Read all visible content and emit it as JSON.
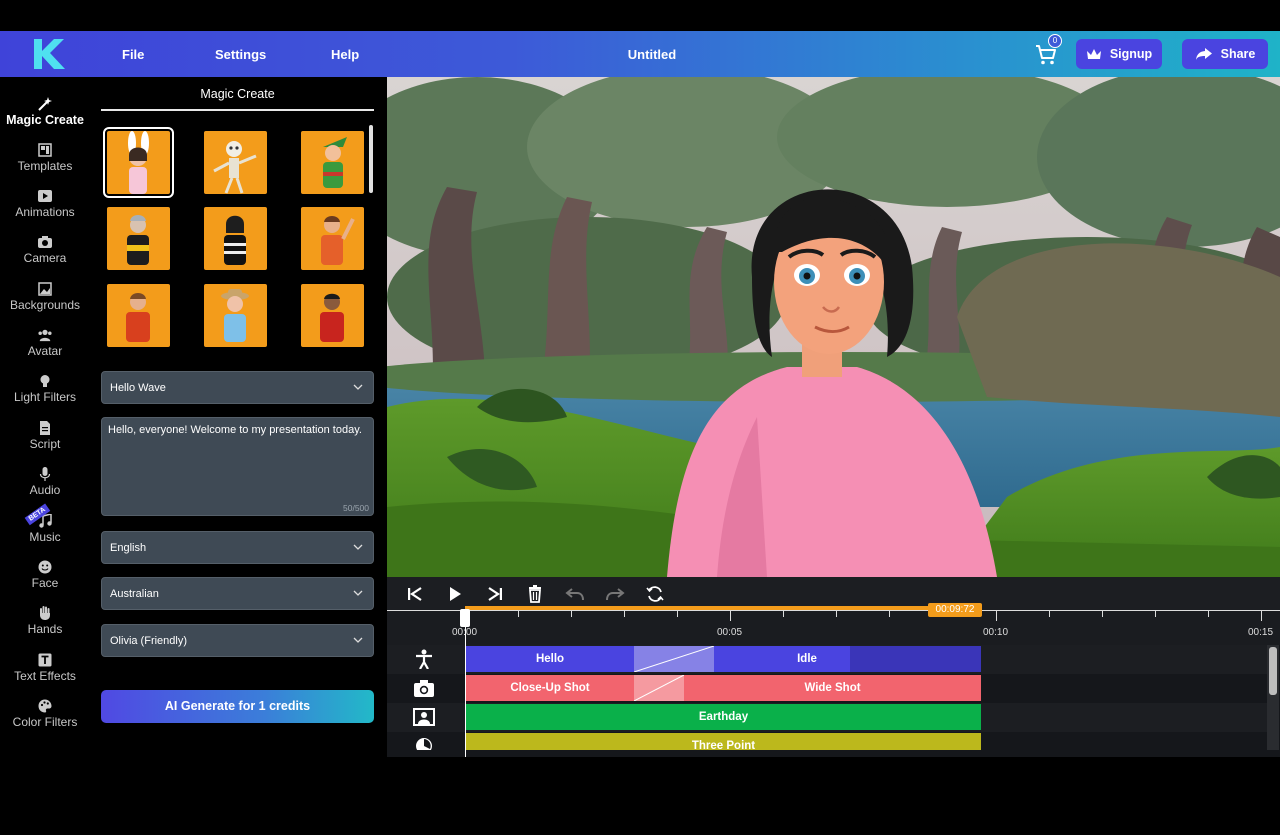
{
  "app": {
    "title": "Untitled",
    "menu": [
      "File",
      "Settings",
      "Help"
    ],
    "cart_count": "0",
    "signup_label": "Signup",
    "share_label": "Share"
  },
  "sidebar": {
    "items": [
      {
        "label": "Magic Create",
        "icon": "magic-wand-icon"
      },
      {
        "label": "Templates",
        "icon": "templates-icon"
      },
      {
        "label": "Animations",
        "icon": "play-icon"
      },
      {
        "label": "Camera",
        "icon": "camera-icon"
      },
      {
        "label": "Backgrounds",
        "icon": "image-icon"
      },
      {
        "label": "Avatar",
        "icon": "people-icon"
      },
      {
        "label": "Light Filters",
        "icon": "bulb-icon"
      },
      {
        "label": "Script",
        "icon": "document-icon"
      },
      {
        "label": "Audio",
        "icon": "microphone-icon"
      },
      {
        "label": "Music",
        "icon": "music-icon",
        "badge": "BETA"
      },
      {
        "label": "Face",
        "icon": "smile-icon"
      },
      {
        "label": "Hands",
        "icon": "hand-icon"
      },
      {
        "label": "Text Effects",
        "icon": "text-icon"
      },
      {
        "label": "Color Filters",
        "icon": "palette-icon"
      }
    ]
  },
  "panel": {
    "title": "Magic Create",
    "animation_select": "Hello Wave",
    "script_text": "Hello, everyone! Welcome to my presentation today.",
    "char_counter": "50/500",
    "language_select": "English",
    "accent_select": "Australian",
    "voice_select": "Olivia (Friendly)",
    "generate_label": "AI Generate for 1 credits"
  },
  "timeline": {
    "current_time": "00:09:72",
    "ticks": [
      "00:00",
      "00:05",
      "00:10",
      "00:15"
    ],
    "tracks": [
      {
        "name": "animation",
        "icon": "person-icon",
        "clips": [
          "Hello",
          "Idle"
        ]
      },
      {
        "name": "camera",
        "icon": "camera-icon",
        "clips": [
          "Close-Up Shot",
          "Wide Shot"
        ]
      },
      {
        "name": "background",
        "icon": "background-icon",
        "clips": [
          "Earthday"
        ]
      },
      {
        "name": "lighting",
        "icon": "light-icon",
        "clips": [
          "Three Point"
        ]
      }
    ]
  },
  "colors": {
    "accent": "#4a44e0",
    "timeline_progress": "#f39c1b",
    "clip_animation": "#4a44e0",
    "clip_camera": "#f2646e",
    "clip_background": "#0ab04a",
    "clip_light": "#bcb81c"
  }
}
